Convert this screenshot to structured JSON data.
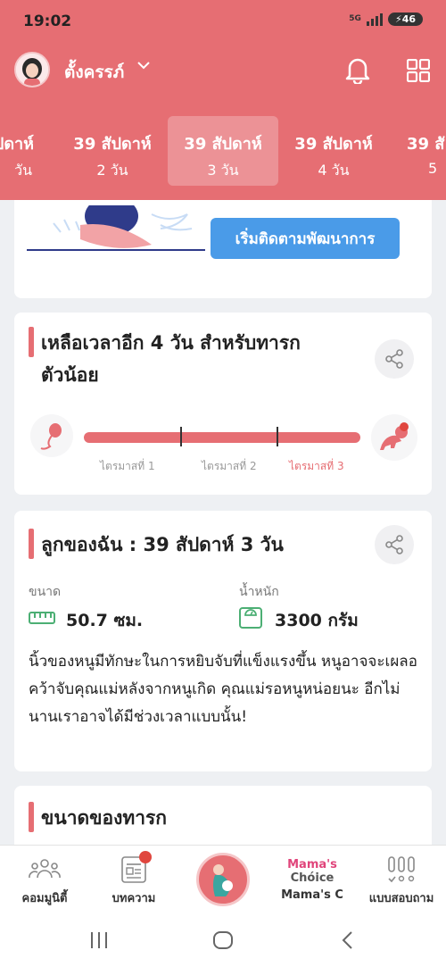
{
  "status": {
    "time": "19:02",
    "network": "5G",
    "battery": "46"
  },
  "user": {
    "name": "ตั้งครรภ์"
  },
  "weeks": [
    {
      "line1": "ปดาห์",
      "line2": "วัน"
    },
    {
      "line1": "39 สัปดาห์",
      "line2": "2 วัน"
    },
    {
      "line1": "39 สัปดาห์",
      "line2": "3 วัน"
    },
    {
      "line1": "39 สัปดาห์",
      "line2": "4 วัน"
    },
    {
      "line1": "39 สั",
      "line2": "5"
    }
  ],
  "track_button": "เริ่มติดตามพัฒนาการ",
  "countdown": {
    "title_line1": "เหลือเวลาอีก 4 วัน สำหรับทารก",
    "title_line2": "ตัวน้อย",
    "trimesters": [
      "ไตรมาสที่ 1",
      "ไตรมาสที่ 2",
      "ไตรมาสที่ 3"
    ]
  },
  "baby": {
    "title": "ลูกของฉัน : 39 สัปดาห์ 3  วัน",
    "size_label": "ขนาด",
    "size_value": "50.7 ซม.",
    "weight_label": "น้ำหนัก",
    "weight_value": "3300 กรัม",
    "description": "นิ้วของหนูมีทักษะในการหยิบจับที่แข็งแรงขึ้น หนูอาจจะเผลอคว้าจับคุณแม่หลังจากหนูเกิด คุณแม่รอหนูหน่อยนะ อีกไม่นานเราอาจได้มีช่วงเวลาแบบนั้น!"
  },
  "baby_size": {
    "title": "ขนาดของทารก"
  },
  "nav": {
    "community": "คอมมูนิตี้",
    "articles": "บทความ",
    "mamas_choice_logo_1": "Mama's",
    "mamas_choice_logo_2": "Chóice",
    "mamas_choice": "Mama's C",
    "quiz": "แบบสอบถาม"
  },
  "colors": {
    "brand": "#e66e73",
    "button": "#4a9be8",
    "active_trimester": "#e66e73"
  }
}
